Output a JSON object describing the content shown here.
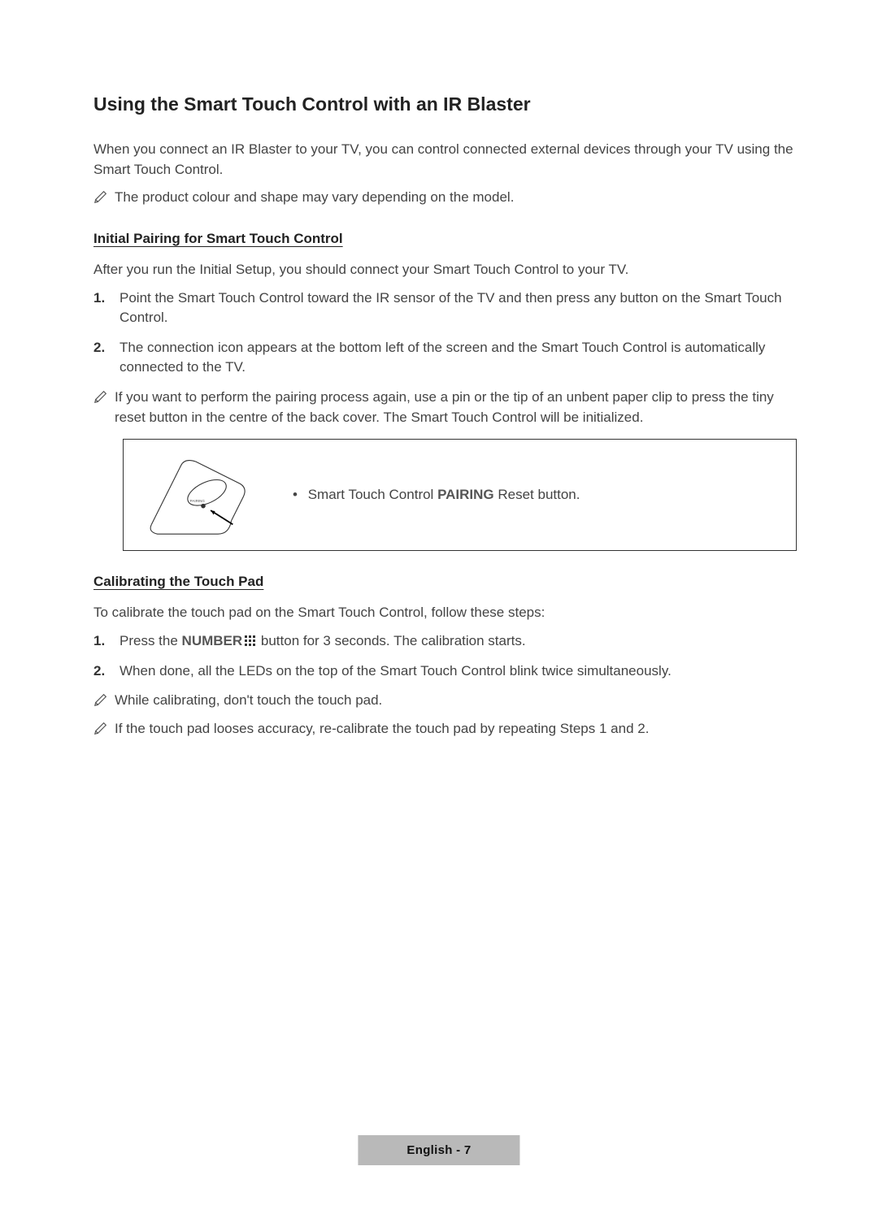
{
  "title": "Using the Smart Touch Control with an IR Blaster",
  "intro": "When you connect an IR Blaster to your TV, you can control connected external devices through your TV using the Smart Touch Control.",
  "note1": "The product colour and shape may vary depending on the model.",
  "section1": {
    "heading": "Initial Pairing for Smart Touch Control",
    "lead": "After you run the Initial Setup, you should connect your Smart Touch Control to your TV.",
    "steps": [
      "Point the Smart Touch Control toward the IR sensor of the TV and then press any button on the Smart Touch Control.",
      "The connection icon appears at the bottom left of the screen and the Smart Touch Control is automatically connected to the TV."
    ],
    "note": "If you want to perform the pairing process again, use a pin or the tip of an unbent paper clip to press the tiny reset button in the centre of the back cover. The Smart Touch Control will be initialized.",
    "diagram_text_pre": "Smart Touch Control ",
    "diagram_text_bold": "PAIRING",
    "diagram_text_post": " Reset button."
  },
  "section2": {
    "heading": "Calibrating the Touch Pad",
    "lead": "To calibrate the touch pad on the Smart Touch Control, follow these steps:",
    "step1_pre": "Press the ",
    "step1_label": "NUMBER",
    "step1_post": " button for 3 seconds. The calibration starts.",
    "step2": "When done, all the LEDs on the top of the Smart Touch Control blink twice simultaneously.",
    "noteA": "While calibrating, don't touch the touch pad.",
    "noteB": "If the touch pad looses accuracy, re-calibrate the touch pad by repeating Steps 1 and 2."
  },
  "footer": "English - 7",
  "ol": {
    "n1": "1.",
    "n2": "2."
  }
}
